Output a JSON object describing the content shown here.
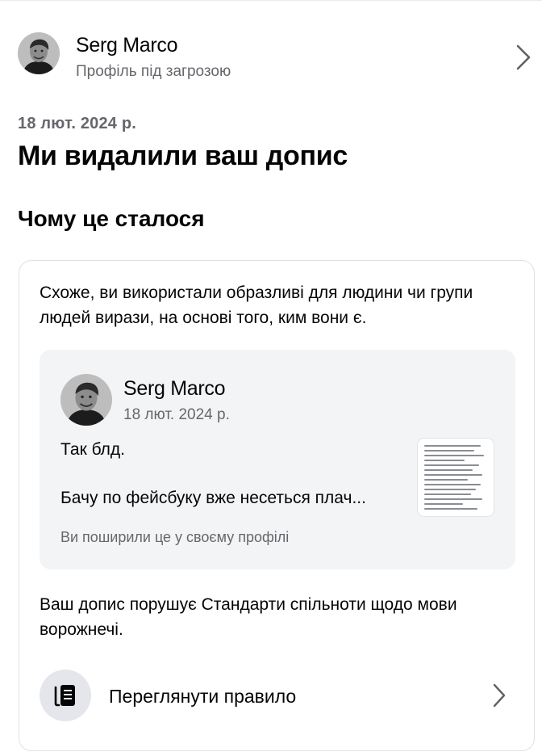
{
  "profile": {
    "name": "Serg Marco",
    "status": "Профіль під загрозою"
  },
  "notice": {
    "date": "18 лют. 2024 р.",
    "title": "Ми видалили ваш допис",
    "reason_heading": "Чому це сталося"
  },
  "card": {
    "description": "Схоже, ви використали образливі для людини чи групи людей вирази, на основі того, ким вони є.",
    "post": {
      "author": "Serg Marco",
      "date": "18 лют. 2024 р.",
      "text_line1": "Так блд.",
      "text_line2": "Бачу по фейсбуку вже несеться плач...",
      "shared_note": "Ви поширили це у своєму профілі"
    },
    "violation_text": "Ваш допис порушує Стандарти спільноти щодо мови ворожнечі.",
    "rule_button_label": "Переглянути правило"
  },
  "icons": {
    "profile_chevron": "chevron-right-icon",
    "rule": "document-stack-icon",
    "rule_chevron": "chevron-right-icon"
  },
  "colors": {
    "text_primary": "#050505",
    "text_secondary": "#65676b",
    "card_border": "#dfe1e5",
    "post_bg": "#f3f4f6",
    "icon_circle_bg": "#e4e6eb"
  }
}
